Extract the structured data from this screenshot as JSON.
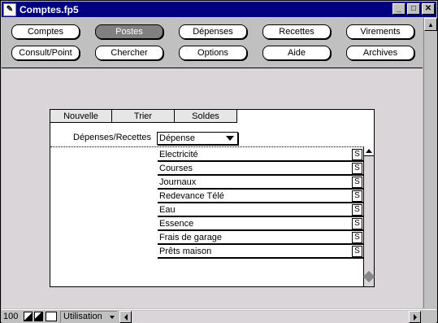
{
  "window": {
    "title": "Comptes.fp5",
    "minimize": "_",
    "maximize": "□",
    "close": "✕"
  },
  "toolbar": {
    "row1": [
      "Comptes",
      "Postes",
      "Dépenses",
      "Recettes",
      "Virements"
    ],
    "row2": [
      "Consult/Point",
      "Chercher",
      "Options",
      "Aide",
      "Archives"
    ],
    "active": "Postes"
  },
  "panel": {
    "tabs": [
      "Nouvelle",
      "Trier",
      "Soldes"
    ],
    "type_label": "Dépenses/Recettes",
    "type_value": "Dépense",
    "rows": [
      {
        "label": "Electricité",
        "button": "S"
      },
      {
        "label": "Courses",
        "button": "S"
      },
      {
        "label": "Journaux",
        "button": "S"
      },
      {
        "label": "Redevance Télé",
        "button": "S"
      },
      {
        "label": "Eau",
        "button": "S"
      },
      {
        "label": "Essence",
        "button": "S"
      },
      {
        "label": "Frais de garage",
        "button": "S"
      },
      {
        "label": "Prêts maison",
        "button": "S"
      }
    ]
  },
  "statusbar": {
    "zoom": "100",
    "mode": "Utilisation"
  }
}
